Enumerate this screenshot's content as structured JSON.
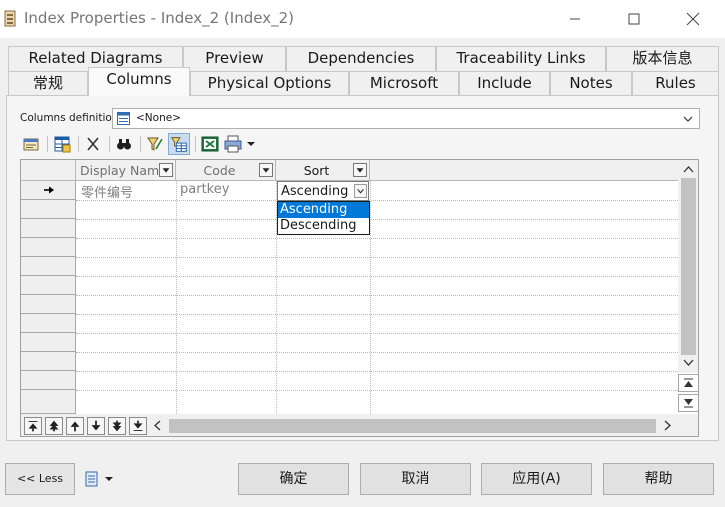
{
  "window": {
    "title": "Index Properties - Index_2 (Index_2)"
  },
  "tabs": {
    "row1": [
      "Related Diagrams",
      "Preview",
      "Dependencies",
      "Traceability Links",
      "版本信息"
    ],
    "row2": [
      "常规",
      "Columns",
      "Physical Options",
      "Microsoft",
      "Include",
      "Notes",
      "Rules"
    ],
    "selected": "Columns"
  },
  "columns_definition": {
    "label": "Columns definition:",
    "value": "<None>"
  },
  "grid": {
    "headers": [
      "Display Nam",
      "Code",
      "Sort"
    ],
    "rows": [
      {
        "display_name": "零件编号",
        "code": "partkey",
        "sort": "Ascending"
      }
    ],
    "sort_options": [
      "Ascending",
      "Descending"
    ],
    "highlighted_option": "Ascending"
  },
  "buttons": {
    "less": "<< Less",
    "ok": "确定",
    "cancel": "取消",
    "apply": "应用(A)",
    "help": "帮助"
  },
  "colors": {
    "selection": "#0078d7",
    "window_bg": "#f0f0f0"
  },
  "icons": [
    "properties-icon",
    "add-columns-icon",
    "delete-icon",
    "find-icon",
    "filter-icon",
    "customize-columns-icon",
    "excel-export-icon",
    "print-icon"
  ]
}
